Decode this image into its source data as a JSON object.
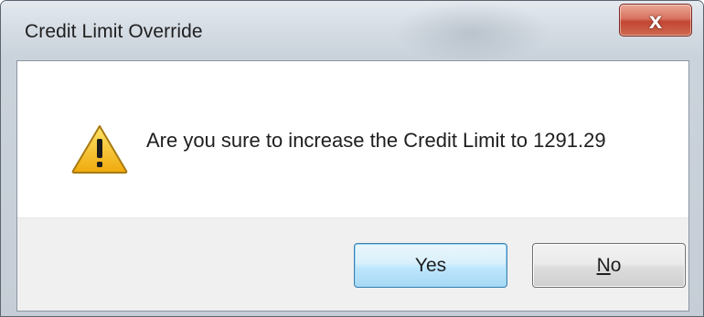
{
  "window": {
    "title": "Credit Limit Override",
    "close_label": "x"
  },
  "dialog": {
    "icon": "warning-icon",
    "message": "Are you sure to increase the Credit Limit to 1291.29"
  },
  "buttons": {
    "yes_label": "Yes",
    "no_mnemonic": "N",
    "no_rest": "o"
  },
  "colors": {
    "warning_fill": "#f5c21a",
    "close_button": "#c24634",
    "default_button_border": "#3c7fb1"
  }
}
